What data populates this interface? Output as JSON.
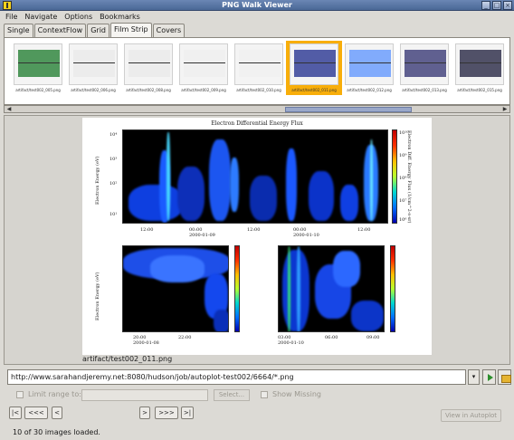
{
  "window": {
    "title": "PNG Walk Viewer"
  },
  "menus": [
    "File",
    "Navigate",
    "Options",
    "Bookmarks"
  ],
  "tabs": [
    {
      "label": "Single",
      "active": false
    },
    {
      "label": "ContextFlow",
      "active": false
    },
    {
      "label": "Grid",
      "active": false
    },
    {
      "label": "Film Strip",
      "active": true
    },
    {
      "label": "Covers",
      "active": false
    }
  ],
  "thumbnails": [
    {
      "caption": "artifact/test002_005.png",
      "selected": false
    },
    {
      "caption": "artifact/test002_006.png",
      "selected": false
    },
    {
      "caption": "artifact/test002_008.png",
      "selected": false
    },
    {
      "caption": "artifact/test002_009.png",
      "selected": false
    },
    {
      "caption": "artifact/test002_010.png",
      "selected": false
    },
    {
      "caption": "artifact/test002_011.png",
      "selected": true
    },
    {
      "caption": "artifact/test002_012.png",
      "selected": false
    },
    {
      "caption": "artifact/test002_013.png",
      "selected": false
    },
    {
      "caption": "artifact/test002_015.png",
      "selected": false
    }
  ],
  "plot": {
    "title": "Electron Differential Energy Flux",
    "ylabel": "Electron Energy (eV)",
    "cbar_label": "Electron Diff. Energy Flux (1/cm^2-s-sr)",
    "yticks": [
      "10⁴",
      "10³",
      "10²",
      "10¹"
    ],
    "cbar_ticks": [
      "10¹⁰",
      "10⁹",
      "10⁸",
      "10⁷",
      "10⁶"
    ],
    "top_xticks": [
      "12:00",
      "00:00\n2000-01-09",
      "12:00",
      "00:00\n2000-01-10",
      "12:00"
    ],
    "left_xticks": [
      "20:00\n2000-01-08",
      "22:00"
    ],
    "right_xticks": [
      "03:00\n2000-01-10",
      "06:00",
      "09:00"
    ]
  },
  "current_file": "artifact/test002_011.png",
  "url": {
    "value": "http://www.sarahandjeremy.net:8080/hudson/job/autoplot-test002/6664/*.png"
  },
  "options": {
    "limit_range_label": "Limit range to:",
    "select_label": "Select...",
    "show_missing_label": "Show Missing"
  },
  "navigation": {
    "first": "|<",
    "prev_page": "<<<",
    "prev": "<",
    "next": ">",
    "next_page": ">>>",
    "last": ">|",
    "view_in_autoplot": "View in Autoplot"
  },
  "status": "10 of 30 images loaded.",
  "colors": {
    "selection": "#f8ae0a",
    "title_bar": "#4a6896",
    "spectrogram_background": "#000000"
  }
}
